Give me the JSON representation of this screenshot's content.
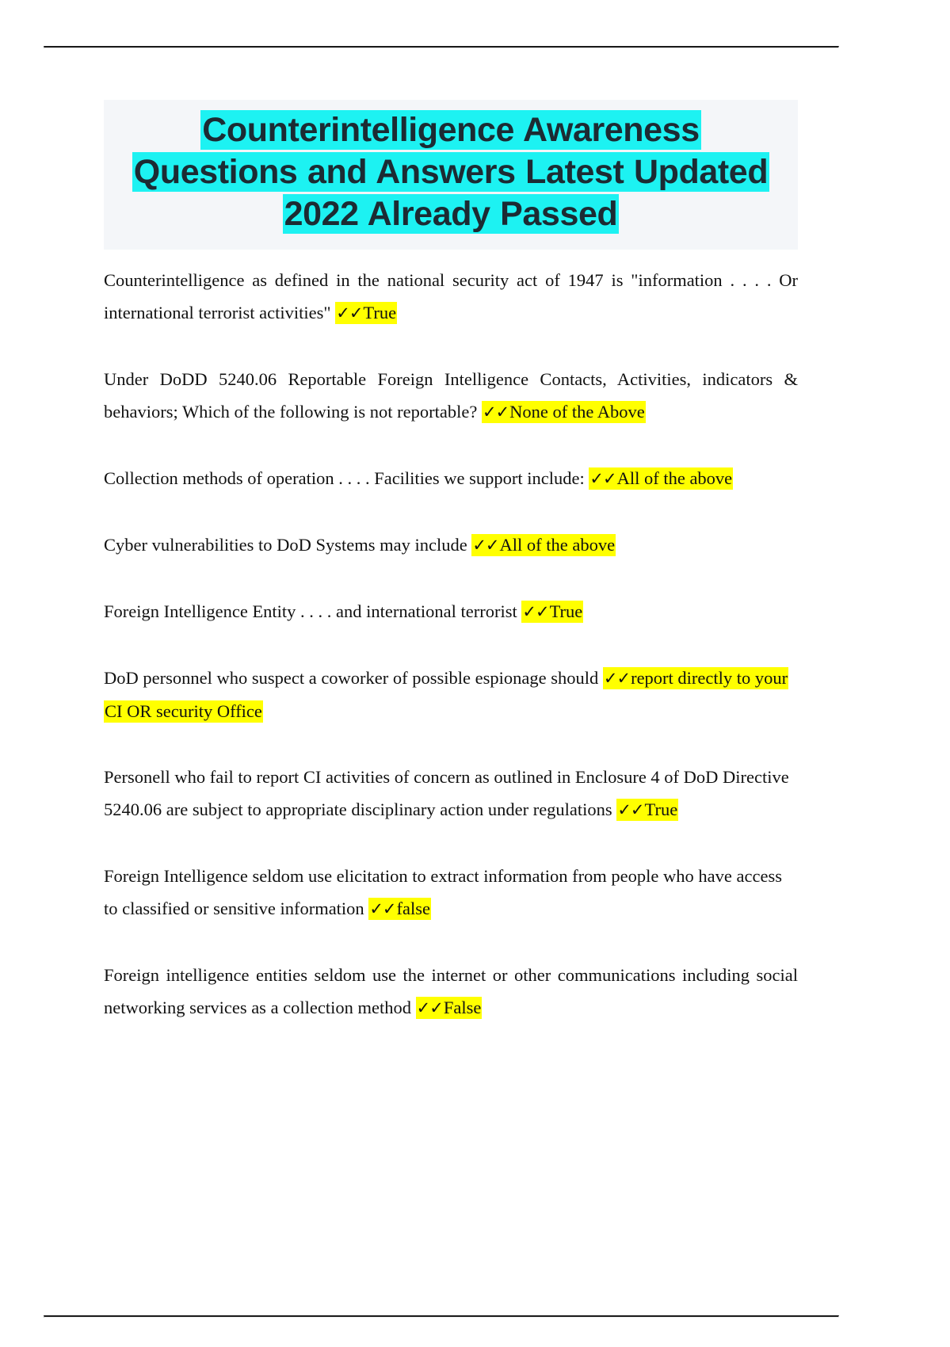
{
  "document": {
    "title_lines": [
      "Counterintelligence Awareness",
      "Questions and Answers Latest Updated",
      "2022 Already Passed"
    ],
    "title_highlight_color": "#1df2f2",
    "answer_highlight_color": "#ffff00",
    "title_block_background": "#f4f6f9",
    "tick_mark": "✓✓"
  },
  "qa": [
    {
      "question": "Counterintelligence as defined in the national security act of 1947 is \"information . . . . Or international terrorist activities\"",
      "answer": "True"
    },
    {
      "question": "Under DoDD 5240.06 Reportable Foreign Intelligence Contacts, Activities, indicators & behaviors; Which of the following is not reportable?",
      "answer": "None of the Above"
    },
    {
      "question": "Collection methods of operation . . . . Facilities we support include:",
      "answer": "All of the above"
    },
    {
      "question": "Cyber vulnerabilities to DoD Systems may include",
      "answer": "All of the above"
    },
    {
      "question": "Foreign Intelligence Entity . . . . and international terrorist",
      "answer": "True"
    },
    {
      "question": "DoD personnel who suspect a coworker of possible espionage should",
      "answer": "report directly to your CI OR security Office"
    },
    {
      "question": "Personell who fail to report CI activities of concern as outlined in Enclosure 4 of DoD Directive 5240.06 are subject to appropriate disciplinary action under regulations",
      "answer": "True"
    },
    {
      "question": "Foreign Intelligence seldom use elicitation to extract information from people who have access to classified or sensitive information",
      "answer": "false"
    },
    {
      "question": "Foreign intelligence entities seldom use the internet or other communications including social networking services as a collection method",
      "answer": "False"
    }
  ]
}
